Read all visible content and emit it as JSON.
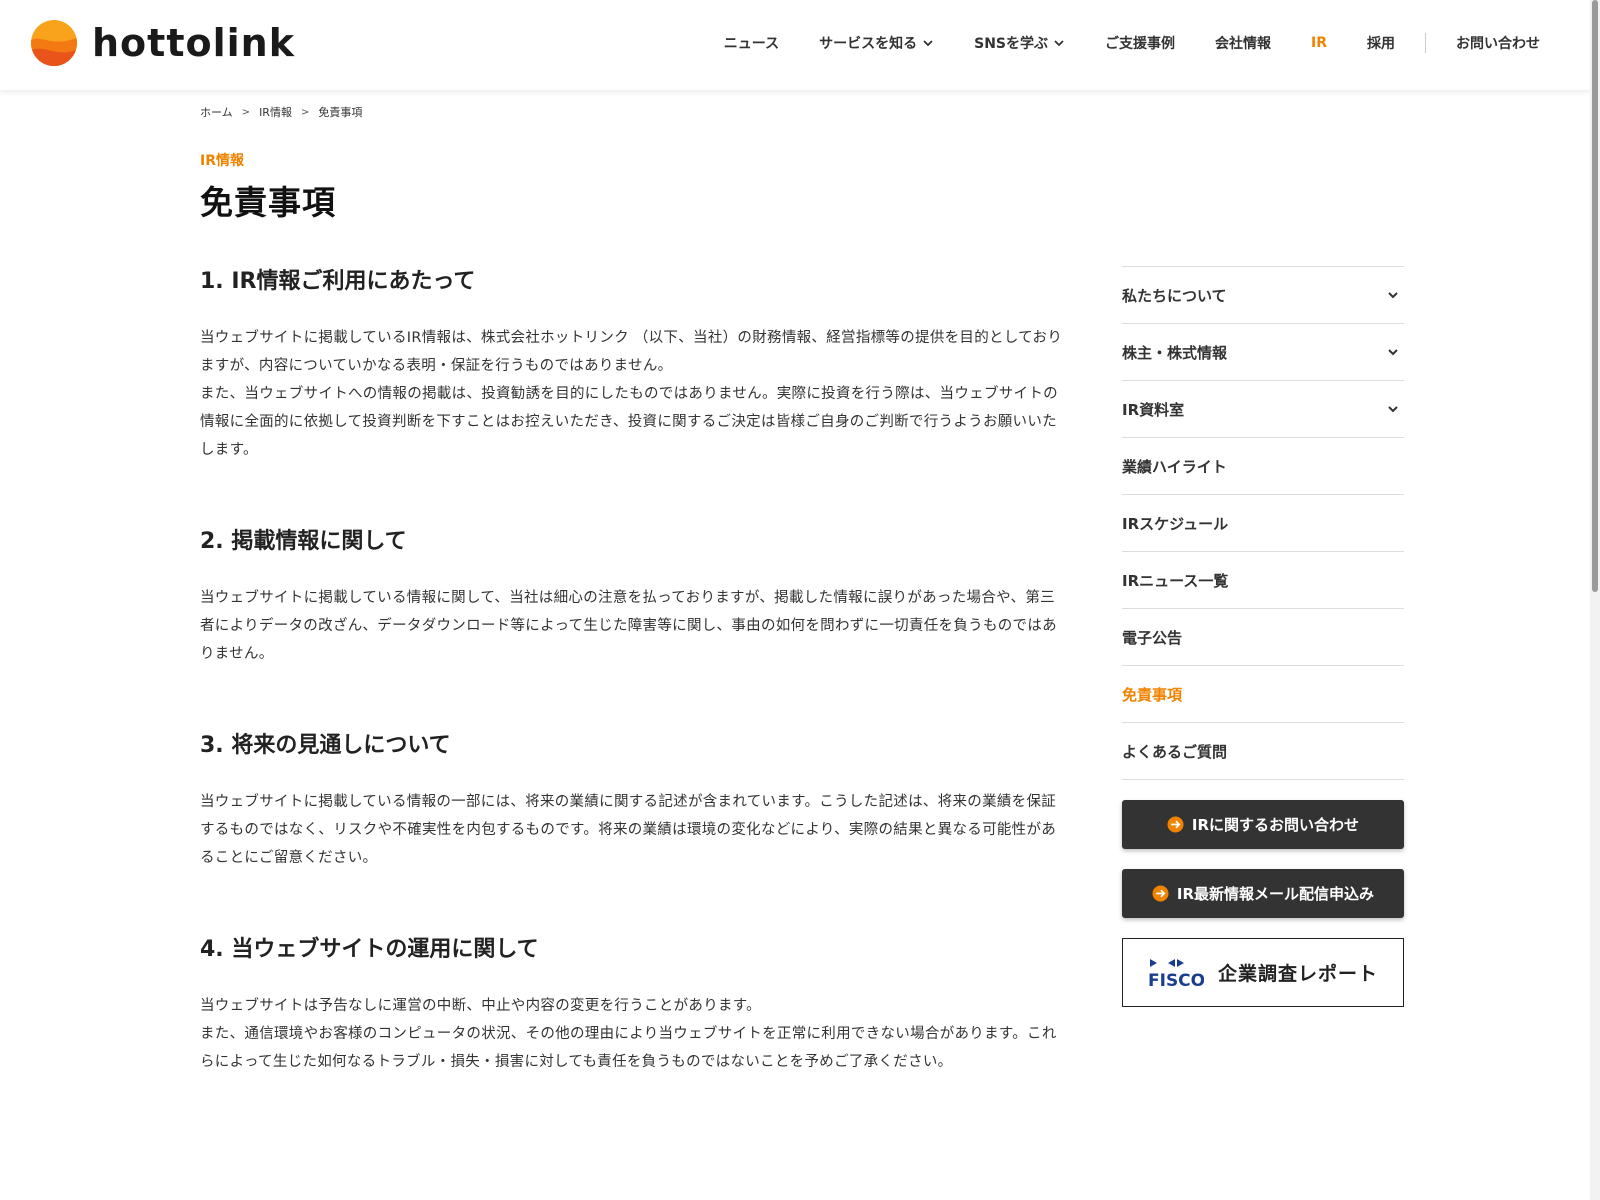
{
  "header": {
    "logo_text": "hottolink",
    "nav": [
      {
        "label": "ニュース"
      },
      {
        "label": "サービスを知る"
      },
      {
        "label": "SNSを学ぶ"
      },
      {
        "label": "ご支援事例"
      },
      {
        "label": "会社情報"
      },
      {
        "label": "IR"
      },
      {
        "label": "採用"
      },
      {
        "label": "お問い合わせ"
      }
    ]
  },
  "breadcrumb": [
    "ホーム",
    "IR情報",
    "免責事項"
  ],
  "section_label": "IR情報",
  "page_title": "免責事項",
  "sections": [
    {
      "heading": "1. IR情報ご利用にあたって",
      "body": "当ウェブサイトに掲載しているIR情報は、株式会社ホットリンク （以下、当社）の財務情報、経営指標等の提供を目的としておりますが、内容についていかなる表明・保証を行うものではありません。\nまた、当ウェブサイトへの情報の掲載は、投資勧誘を目的にしたものではありません。実際に投資を行う際は、当ウェブサイトの情報に全面的に依拠して投資判断を下すことはお控えいただき、投資に関するご決定は皆様ご自身のご判断で行うようお願いいたします。"
    },
    {
      "heading": "2. 掲載情報に関して",
      "body": "当ウェブサイトに掲載している情報に関して、当社は細心の注意を払っておりますが、掲載した情報に誤りがあった場合や、第三者によりデータの改ざん、データダウンロード等によって生じた障害等に関し、事由の如何を問わずに一切責任を負うものではありません。"
    },
    {
      "heading": "3. 将来の見通しについて",
      "body": "当ウェブサイトに掲載している情報の一部には、将来の業績に関する記述が含まれています。こうした記述は、将来の業績を保証するものではなく、リスクや不確実性を内包するものです。将来の業績は環境の変化などにより、実際の結果と異なる可能性があることにご留意ください。"
    },
    {
      "heading": "4. 当ウェブサイトの運用に関して",
      "body": "当ウェブサイトは予告なしに運営の中断、中止や内容の変更を行うことがあります。\nまた、通信環境やお客様のコンピュータの状況、その他の理由により当ウェブサイトを正常に利用できない場合があります。これらによって生じた如何なるトラブル・損失・損害に対しても責任を負うものではないことを予めご了承ください。"
    }
  ],
  "sidebar": {
    "items": [
      {
        "label": "私たちについて"
      },
      {
        "label": "株主・株式情報"
      },
      {
        "label": "IR資料室"
      },
      {
        "label": "業績ハイライト"
      },
      {
        "label": "IRスケジュール"
      },
      {
        "label": "IRニュース一覧"
      },
      {
        "label": "電子公告"
      },
      {
        "label": "免責事項"
      },
      {
        "label": "よくあるご質問"
      }
    ],
    "contact_button": "IRに関するお問い合わせ",
    "mail_button": "IR最新情報メール配信申込み",
    "fisco_logo": "FISCO",
    "fisco_label": "企業調査レポート"
  },
  "colors": {
    "accent": "#f08300",
    "dark_button": "#333333"
  }
}
